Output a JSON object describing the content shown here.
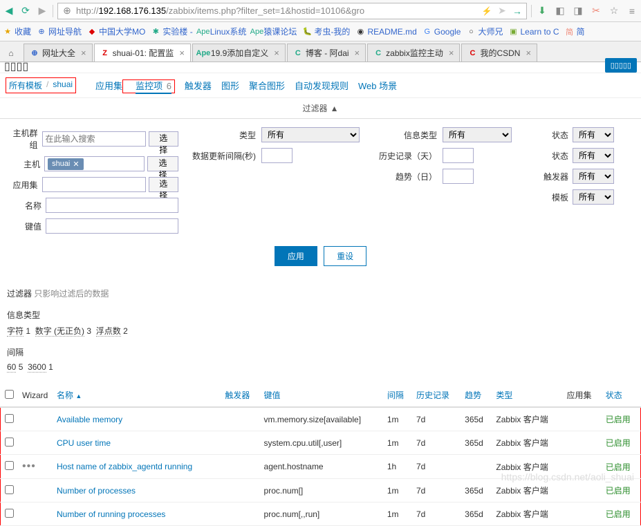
{
  "browser": {
    "url_prefix": "http://",
    "url_ip": "192.168.176.135",
    "url_path": "/zabbix/items.php?filter_set=1&hostid=10106&gro"
  },
  "bookmarks": [
    {
      "label": "收藏",
      "icon": "★",
      "color": "#e6a400"
    },
    {
      "label": "网址导航",
      "icon": "⊕",
      "color": "#3366cc"
    },
    {
      "label": "中国大学MO",
      "icon": "◆",
      "color": "#d00"
    },
    {
      "label": "实验楼 -",
      "icon": "✱",
      "color": "#2a8"
    },
    {
      "label": "Linux系统",
      "icon": "Ape",
      "color": "#2a8"
    },
    {
      "label": "猿课论坛",
      "icon": "Ape",
      "color": "#2a8"
    },
    {
      "label": "考虫-我的",
      "icon": "🐛",
      "color": "#fb0"
    },
    {
      "label": "README.md",
      "icon": "◉",
      "color": "#333"
    },
    {
      "label": "Google",
      "icon": "G",
      "color": "#4285f4"
    },
    {
      "label": "大师兄",
      "icon": "○",
      "color": "#333"
    },
    {
      "label": "Learn to C",
      "icon": "▣",
      "color": "#7a3"
    },
    {
      "label": "简",
      "icon": "简",
      "color": "#e87"
    }
  ],
  "tabs": [
    {
      "label": "网址大全",
      "icon": "⊕",
      "color": "#3366cc"
    },
    {
      "label": "shuai-01: 配置监",
      "icon": "Z",
      "color": "#d00",
      "active": true
    },
    {
      "label": "19.9添加自定义",
      "icon": "Ape",
      "color": "#2a8"
    },
    {
      "label": "博客 - 阿dai",
      "icon": "C",
      "color": "#2a8"
    },
    {
      "label": "zabbix监控主动",
      "icon": "C",
      "color": "#2a8"
    },
    {
      "label": "我的CSDN",
      "icon": "C",
      "color": "#d00"
    }
  ],
  "nav": {
    "bc1": "所有模板",
    "bc2": "shuai",
    "items": [
      {
        "label": "应用集"
      },
      {
        "label": "监控项",
        "count": "6",
        "active": true
      },
      {
        "label": "触发器"
      },
      {
        "label": "图形"
      },
      {
        "label": "聚合图形"
      },
      {
        "label": "自动发现规则"
      },
      {
        "label": "Web 场景"
      }
    ]
  },
  "filter_toggle": "过滤器",
  "form": {
    "labels": {
      "host_group": "主机群组",
      "host": "主机",
      "app": "应用集",
      "name": "名称",
      "key": "键值",
      "type": "类型",
      "update_interval": "数据更新间隔(秒)",
      "info_type": "信息类型",
      "history": "历史记录（天）",
      "trend": "趋势（日）",
      "state": "状态",
      "status": "状态",
      "trigger": "触发器",
      "template": "模板"
    },
    "placeholder_search": "在此输入搜索",
    "select_all": "所有",
    "btn_select": "选择",
    "host_tag": "shuai",
    "btn_apply": "应用",
    "btn_reset": "重设"
  },
  "summary": {
    "filter_label": "过滤器",
    "filter_note": "只影响过滤后的数据",
    "info_type": "信息类型",
    "char": "字符",
    "char_n": "1",
    "num": "数字 (无正负)",
    "num_n": "3",
    "float": "浮点数",
    "float_n": "2",
    "interval_label": "间隔",
    "i1": "60",
    "i1n": "5",
    "i2": "3600",
    "i2n": "1"
  },
  "table": {
    "headers": {
      "wizard": "Wizard",
      "name": "名称",
      "trigger": "触发器",
      "key": "键值",
      "interval": "间隔",
      "history": "历史记录",
      "trend": "趋势",
      "type": "类型",
      "app": "应用集",
      "status": "状态"
    },
    "rows": [
      {
        "name": "Available memory",
        "key": "vm.memory.size[available]",
        "interval": "1m",
        "history": "7d",
        "trend": "365d",
        "type": "Zabbix 客户端",
        "status": "已启用"
      },
      {
        "name": "CPU user time",
        "key": "system.cpu.util[,user]",
        "interval": "1m",
        "history": "7d",
        "trend": "365d",
        "type": "Zabbix 客户端",
        "status": "已启用"
      },
      {
        "name": "Host name of zabbix_agentd running",
        "key": "agent.hostname",
        "interval": "1h",
        "history": "7d",
        "trend": "",
        "type": "Zabbix 客户端",
        "status": "已启用",
        "wizard": true
      },
      {
        "name": "Number of processes",
        "key": "proc.num[]",
        "interval": "1m",
        "history": "7d",
        "trend": "365d",
        "type": "Zabbix 客户端",
        "status": "已启用"
      },
      {
        "name": "Number of running processes",
        "key": "proc.num[,,run]",
        "interval": "1m",
        "history": "7d",
        "trend": "365d",
        "type": "Zabbix 客户端",
        "status": "已启用"
      }
    ]
  }
}
